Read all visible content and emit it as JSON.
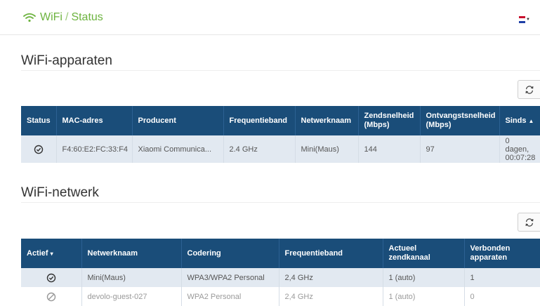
{
  "header": {
    "breadcrumb_wifi": "WiFi",
    "breadcrumb_sep": "/",
    "breadcrumb_page": "Status",
    "language_flag": "nl-flag-icon"
  },
  "devices": {
    "title": "WiFi-apparaten",
    "refresh_icon": "refresh-icon",
    "columns": {
      "status": "Status",
      "mac": "MAC-adres",
      "producer": "Producent",
      "band": "Frequentieband",
      "network": "Netwerknaam",
      "tx_1": "Zendsnelheid",
      "tx_2": "(Mbps)",
      "rx_1": "Ontvangstsnelheid",
      "rx_2": "(Mbps)",
      "since": "Sinds",
      "since_sort": "▲"
    },
    "rows": [
      {
        "status_icon": "check-circle-icon",
        "mac": "F4:60:E2:FC:33:F4",
        "producer": "Xiaomi Communica...",
        "band": "2.4 GHz",
        "network": "Mini(Maus)",
        "tx": "144",
        "rx": "97",
        "since_1": "0 dagen,",
        "since_2": "00:07:28"
      }
    ]
  },
  "networks": {
    "title": "WiFi-netwerk",
    "refresh_icon": "refresh-icon",
    "columns": {
      "active": "Actief",
      "active_sort": "▾",
      "network": "Netwerknaam",
      "encryption": "Codering",
      "band": "Frequentieband",
      "channel_1": "Actueel",
      "channel_2": "zendkanaal",
      "connected_1": "Verbonden",
      "connected_2": "apparaten"
    },
    "rows": [
      {
        "active_icon": "check-circle-icon",
        "network": "Mini(Maus)",
        "encryption": "WPA3/WPA2 Personal",
        "band": "2,4 GHz",
        "channel": "1 (auto)",
        "connected": "1"
      },
      {
        "active_icon": "disabled-circle-icon",
        "network": "devolo-guest-027",
        "encryption": "WPA2 Personal",
        "band": "2,4 GHz",
        "channel": "1 (auto)",
        "connected": "0"
      }
    ]
  },
  "colors": {
    "accent_green": "#6db33f",
    "table_header": "#1a4d79",
    "row_highlight": "#e2e9f1"
  }
}
